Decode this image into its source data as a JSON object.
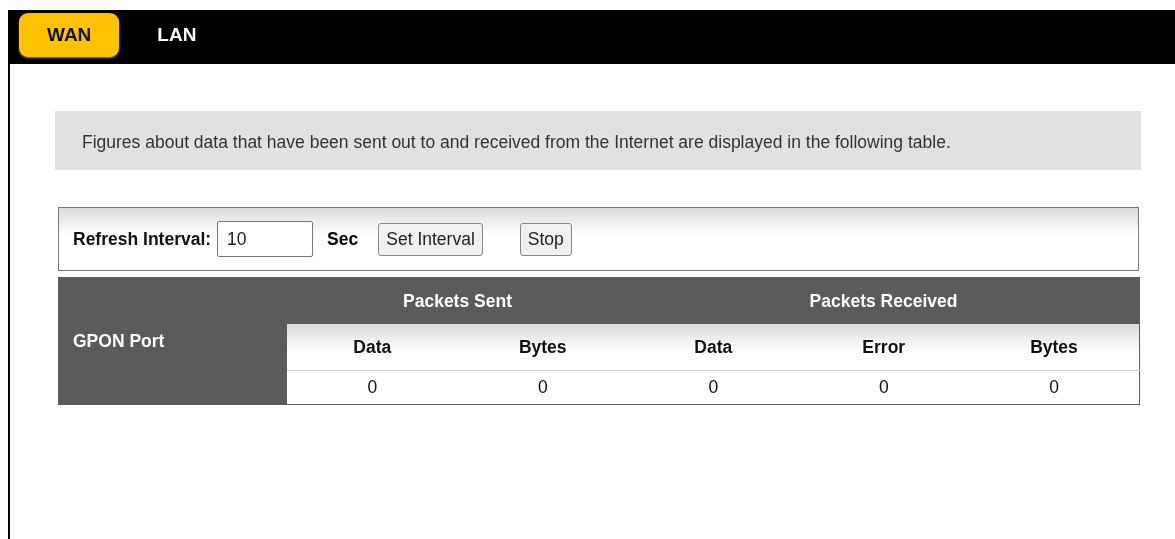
{
  "tabs": [
    {
      "label": "WAN",
      "selected": true
    },
    {
      "label": "LAN",
      "selected": false
    }
  ],
  "description": "Figures about data that have been sent out to and received from the Internet are displayed in the following table.",
  "refresh": {
    "label": "Refresh Interval:",
    "value": "10",
    "unit": "Sec",
    "buttons": [
      "Set Interval",
      "Stop"
    ]
  },
  "table": {
    "row_header": "GPON Port",
    "groups": [
      {
        "label": "Packets Sent",
        "columns": [
          "Data",
          "Bytes"
        ]
      },
      {
        "label": "Packets Received",
        "columns": [
          "Data",
          "Error",
          "Bytes"
        ]
      }
    ],
    "rows": [
      {
        "cells": [
          "0",
          "0",
          "0",
          "0",
          "0"
        ]
      }
    ]
  }
}
